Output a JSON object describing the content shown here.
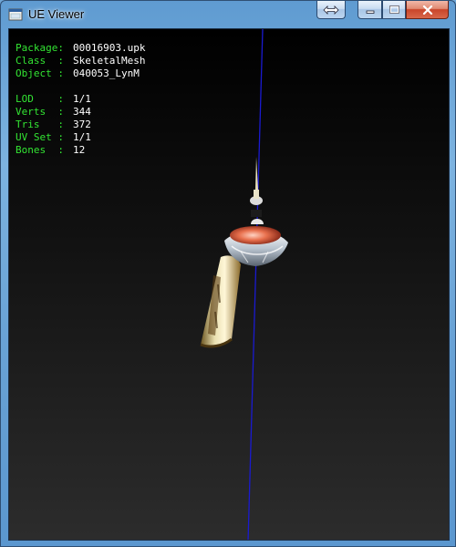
{
  "window": {
    "title": "UE Viewer",
    "accent": "#6fa6d6",
    "buttons": [
      "swap-icon",
      "minimize-icon",
      "maximize-icon",
      "close-icon"
    ]
  },
  "info_panel": {
    "label_color": "#33e533",
    "value_color": "#ffffff",
    "rows": [
      {
        "label": "Package:",
        "value": "00016903.upk"
      },
      {
        "label": "Class  :",
        "value": "SkeletalMesh"
      },
      {
        "label": "Object :",
        "value": "040053_LynM"
      }
    ],
    "stats": [
      {
        "label": "LOD    :",
        "value": "1/1"
      },
      {
        "label": "Verts  :",
        "value": "344"
      },
      {
        "label": "Tris   :",
        "value": "372"
      },
      {
        "label": "UV Set :",
        "value": "1/1"
      },
      {
        "label": "Bones  :",
        "value": "12"
      }
    ]
  },
  "scene": {
    "axis_color": "#1a1ad0",
    "object": "skeletal-mesh-model"
  }
}
